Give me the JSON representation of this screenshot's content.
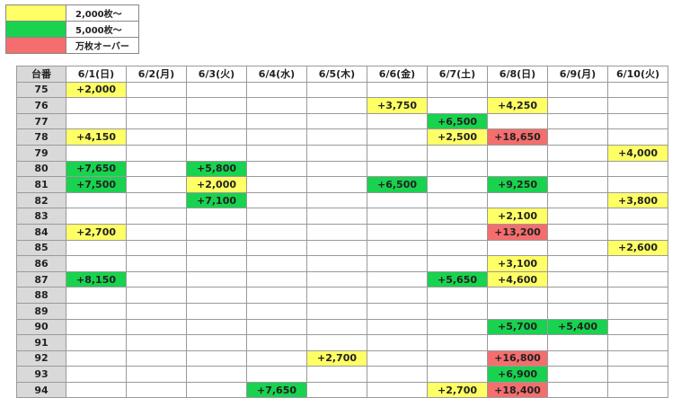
{
  "colors": {
    "yellow": "#ffff66",
    "green": "#19d24f",
    "red": "#f46e6e",
    "header_gray": "#d9d9d9"
  },
  "legend": [
    {
      "color": "yellow",
      "label": "2,000枚～"
    },
    {
      "color": "green",
      "label": "5,000枚～"
    },
    {
      "color": "red",
      "label": "万枚オーバー"
    }
  ],
  "table": {
    "corner": "台番",
    "days": [
      "6/1(日)",
      "6/2(月)",
      "6/3(火)",
      "6/4(水)",
      "6/5(木)",
      "6/6(金)",
      "6/7(土)",
      "6/8(日)",
      "6/9(月)",
      "6/10(火)"
    ],
    "rows": [
      {
        "no": "75",
        "cells": [
          {
            "d": 0,
            "v": "+2,000",
            "c": "yellow"
          }
        ]
      },
      {
        "no": "76",
        "cells": [
          {
            "d": 5,
            "v": "+3,750",
            "c": "yellow"
          },
          {
            "d": 7,
            "v": "+4,250",
            "c": "yellow"
          }
        ]
      },
      {
        "no": "77",
        "cells": [
          {
            "d": 6,
            "v": "+6,500",
            "c": "green"
          }
        ]
      },
      {
        "no": "78",
        "cells": [
          {
            "d": 0,
            "v": "+4,150",
            "c": "yellow"
          },
          {
            "d": 6,
            "v": "+2,500",
            "c": "yellow"
          },
          {
            "d": 7,
            "v": "+18,650",
            "c": "red"
          }
        ]
      },
      {
        "no": "79",
        "cells": [
          {
            "d": 9,
            "v": "+4,000",
            "c": "yellow"
          }
        ]
      },
      {
        "no": "80",
        "cells": [
          {
            "d": 0,
            "v": "+7,650",
            "c": "green"
          },
          {
            "d": 2,
            "v": "+5,800",
            "c": "green"
          }
        ]
      },
      {
        "no": "81",
        "cells": [
          {
            "d": 0,
            "v": "+7,500",
            "c": "green"
          },
          {
            "d": 2,
            "v": "+2,000",
            "c": "yellow"
          },
          {
            "d": 5,
            "v": "+6,500",
            "c": "green"
          },
          {
            "d": 7,
            "v": "+9,250",
            "c": "green"
          }
        ]
      },
      {
        "no": "82",
        "cells": [
          {
            "d": 2,
            "v": "+7,100",
            "c": "green"
          },
          {
            "d": 9,
            "v": "+3,800",
            "c": "yellow"
          }
        ]
      },
      {
        "no": "83",
        "cells": [
          {
            "d": 7,
            "v": "+2,100",
            "c": "yellow"
          }
        ]
      },
      {
        "no": "84",
        "cells": [
          {
            "d": 0,
            "v": "+2,700",
            "c": "yellow"
          },
          {
            "d": 7,
            "v": "+13,200",
            "c": "red"
          }
        ]
      },
      {
        "no": "85",
        "cells": [
          {
            "d": 9,
            "v": "+2,600",
            "c": "yellow"
          }
        ]
      },
      {
        "no": "86",
        "cells": [
          {
            "d": 7,
            "v": "+3,100",
            "c": "yellow"
          }
        ]
      },
      {
        "no": "87",
        "cells": [
          {
            "d": 0,
            "v": "+8,150",
            "c": "green"
          },
          {
            "d": 6,
            "v": "+5,650",
            "c": "green"
          },
          {
            "d": 7,
            "v": "+4,600",
            "c": "yellow"
          }
        ]
      },
      {
        "no": "88",
        "cells": []
      },
      {
        "no": "89",
        "cells": []
      },
      {
        "no": "90",
        "cells": [
          {
            "d": 7,
            "v": "+5,700",
            "c": "green"
          },
          {
            "d": 8,
            "v": "+5,400",
            "c": "green"
          }
        ]
      },
      {
        "no": "91",
        "cells": []
      },
      {
        "no": "92",
        "cells": [
          {
            "d": 4,
            "v": "+2,700",
            "c": "yellow"
          },
          {
            "d": 7,
            "v": "+16,800",
            "c": "red"
          }
        ]
      },
      {
        "no": "93",
        "cells": [
          {
            "d": 7,
            "v": "+6,900",
            "c": "green"
          }
        ]
      },
      {
        "no": "94",
        "cells": [
          {
            "d": 3,
            "v": "+7,650",
            "c": "green"
          },
          {
            "d": 6,
            "v": "+2,700",
            "c": "yellow"
          },
          {
            "d": 7,
            "v": "+18,400",
            "c": "red"
          }
        ]
      }
    ]
  }
}
